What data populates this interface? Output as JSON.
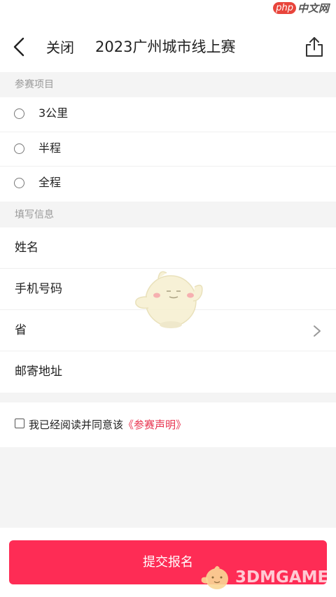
{
  "watermark": {
    "php": "php",
    "cn": "中文网",
    "brand": "3DMGAME"
  },
  "header": {
    "close_label": "关闭",
    "title": "2023广州城市线上赛",
    "back_icon": "chevron-left-icon",
    "share_icon": "share-upload-icon"
  },
  "sections": {
    "event_title": "参赛项目",
    "info_title": "填写信息"
  },
  "events": [
    {
      "label": "3公里"
    },
    {
      "label": "半程"
    },
    {
      "label": "全程"
    }
  ],
  "info_fields": [
    {
      "label": "姓名"
    },
    {
      "label": "手机号码"
    },
    {
      "label": "省"
    },
    {
      "label": "邮寄地址"
    }
  ],
  "agreement": {
    "text": "我已经阅读并同意该",
    "link": "《参赛声明》"
  },
  "submit": {
    "label": "提交报名"
  },
  "colors": {
    "accent": "#fe2c55",
    "link": "#e8324e"
  }
}
